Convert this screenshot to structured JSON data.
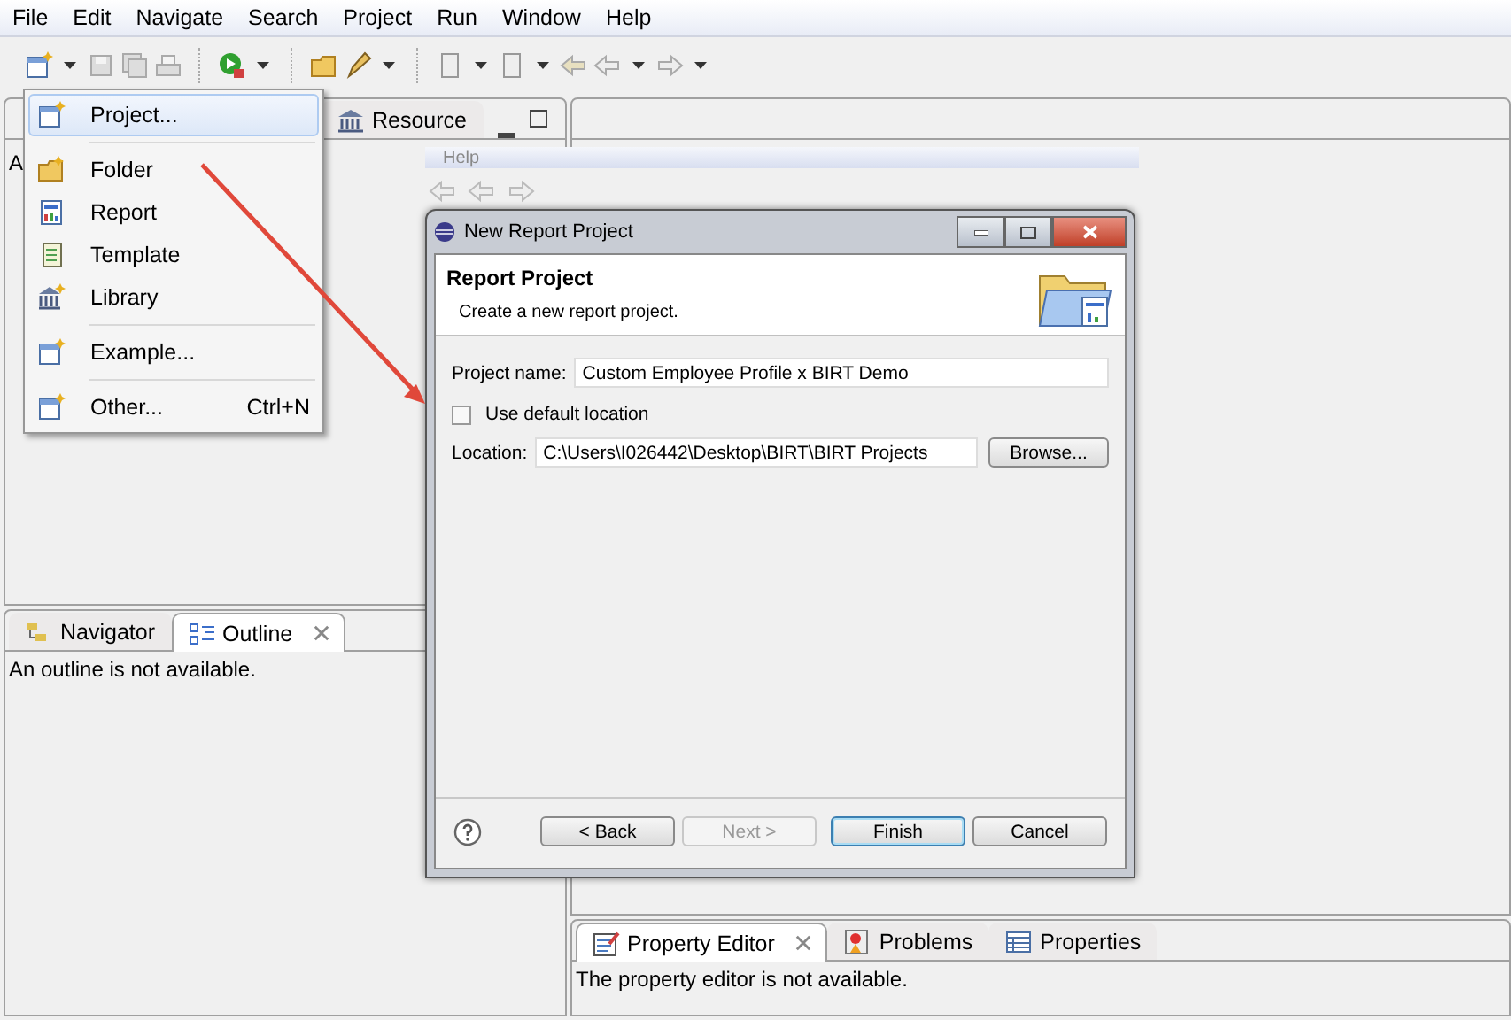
{
  "menu_bar": [
    "File",
    "Edit",
    "Navigate",
    "Search",
    "Project",
    "Run",
    "Window",
    "Help"
  ],
  "left_top_panel": {
    "tabs": [
      {
        "label": "Resource",
        "selected": false
      }
    ],
    "content": "A"
  },
  "new_menu": {
    "items": [
      {
        "kind": "item",
        "label": "Project...",
        "selected": true
      },
      {
        "kind": "separator"
      },
      {
        "kind": "item",
        "label": "Folder",
        "selected": false
      },
      {
        "kind": "item",
        "label": "Report",
        "selected": false
      },
      {
        "kind": "item",
        "label": "Template",
        "selected": false
      },
      {
        "kind": "item",
        "label": "Library",
        "selected": false
      },
      {
        "kind": "separator"
      },
      {
        "kind": "item",
        "label": "Example...",
        "selected": false
      },
      {
        "kind": "separator"
      },
      {
        "kind": "item",
        "label": "Other...",
        "shortcut": "Ctrl+N",
        "selected": false
      }
    ]
  },
  "background_window": {
    "menu_item": "Help"
  },
  "left_bottom_panel": {
    "tabs": [
      {
        "label": "Navigator",
        "selected": false,
        "closable": false
      },
      {
        "label": "Outline",
        "selected": true,
        "closable": true
      }
    ],
    "message": "An outline is not available."
  },
  "dialog": {
    "title": "New Report Project",
    "heading": "Report Project",
    "description": "Create a new report project.",
    "project_name_label": "Project name:",
    "project_name": "Custom Employee Profile x BIRT Demo",
    "use_default_location": {
      "label": "Use default location",
      "checked": false
    },
    "location_label": "Location:",
    "location": "C:\\Users\\I026442\\Desktop\\BIRT\\BIRT Projects",
    "browse": "Browse...",
    "buttons": [
      {
        "label": "< Back",
        "disabled": false,
        "default": false
      },
      {
        "label": "Next >",
        "disabled": true,
        "default": false
      },
      {
        "label": "Finish",
        "disabled": false,
        "default": true
      },
      {
        "label": "Cancel",
        "disabled": false,
        "default": false
      }
    ]
  },
  "right_bottom_panel": {
    "tabs": [
      {
        "label": "Property Editor",
        "selected": true,
        "closable": true
      },
      {
        "label": "Problems",
        "selected": false,
        "closable": false
      },
      {
        "label": "Properties",
        "selected": false,
        "closable": false
      }
    ],
    "message": "The property editor is not available."
  }
}
